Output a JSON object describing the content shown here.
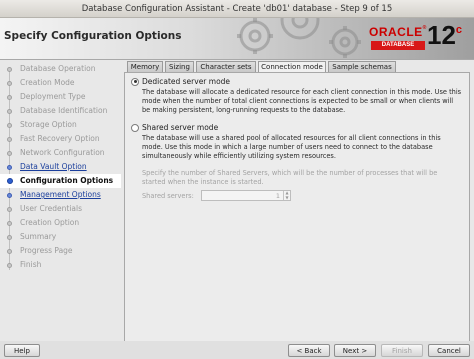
{
  "window": {
    "title": "Database Configuration Assistant - Create 'db01' database - Step 9 of 15"
  },
  "banner": {
    "heading": "Specify Configuration Options",
    "brand": "ORACLE",
    "product": "DATABASE",
    "version": "12",
    "version_suffix": "c"
  },
  "steps": [
    {
      "label": "Database Operation",
      "state": "done"
    },
    {
      "label": "Creation Mode",
      "state": "done"
    },
    {
      "label": "Deployment Type",
      "state": "done"
    },
    {
      "label": "Database Identification",
      "state": "done"
    },
    {
      "label": "Storage Option",
      "state": "done"
    },
    {
      "label": "Fast Recovery Option",
      "state": "done"
    },
    {
      "label": "Network Configuration",
      "state": "done"
    },
    {
      "label": "Data Vault Option",
      "state": "link"
    },
    {
      "label": "Configuration Options",
      "state": "active"
    },
    {
      "label": "Management Options",
      "state": "link"
    },
    {
      "label": "User Credentials",
      "state": "pending"
    },
    {
      "label": "Creation Option",
      "state": "pending"
    },
    {
      "label": "Summary",
      "state": "pending"
    },
    {
      "label": "Progress Page",
      "state": "pending"
    },
    {
      "label": "Finish",
      "state": "pending"
    }
  ],
  "tabs": [
    {
      "label": "Memory"
    },
    {
      "label": "Sizing"
    },
    {
      "label": "Character sets"
    },
    {
      "label": "Connection mode",
      "active": true
    },
    {
      "label": "Sample schemas"
    }
  ],
  "connection": {
    "dedicated_label": "Dedicated server mode",
    "dedicated_desc": "The database will allocate a dedicated resource for each client connection in this mode. Use this mode when the number of total client connections is expected to be small or when clients will be making persistent, long-running requests to the database.",
    "shared_label": "Shared server mode",
    "shared_desc": "The database will use a shared pool of allocated resources for all client connections in this mode. Use this mode in which a large number of users need to connect to the database simultaneously while efficiently utilizing system resources.",
    "shared_hint": "Specify the number of Shared Servers, which will be the number of processes that will be started when the instance is started.",
    "shared_servers_label": "Shared servers:",
    "shared_servers_value": "1",
    "selected": "dedicated"
  },
  "footer": {
    "help": "Help",
    "back": "< Back",
    "next": "Next >",
    "finish": "Finish",
    "cancel": "Cancel"
  }
}
